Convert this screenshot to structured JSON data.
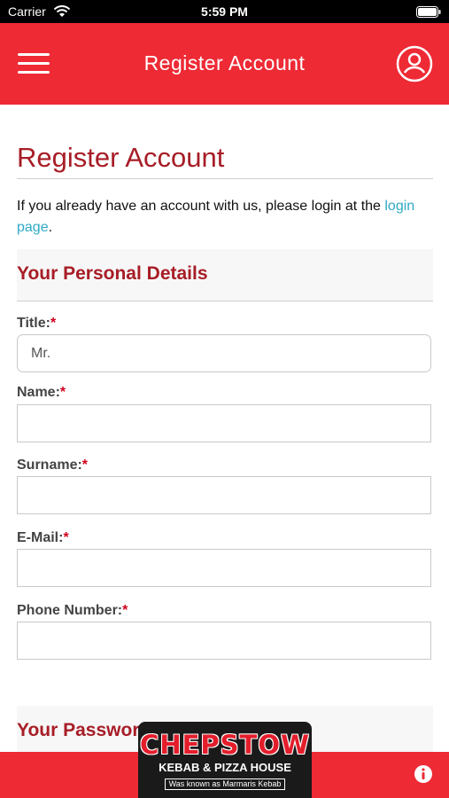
{
  "status": {
    "carrier": "Carrier",
    "time": "5:59 PM"
  },
  "header": {
    "title": "Register Account",
    "menu_icon": "hamburger-menu-icon",
    "account_icon": "user-circle-icon",
    "color": "#ee2a35"
  },
  "page": {
    "title": "Register Account",
    "intro_text": "If you already have an account with us, please login at the ",
    "intro_link": "login page",
    "intro_end": "."
  },
  "personal_section": {
    "title": "Your Personal Details",
    "fields": [
      {
        "label": "Title:",
        "value": "Mr."
      },
      {
        "label": "Name:",
        "value": ""
      },
      {
        "label": "Surname:",
        "value": ""
      },
      {
        "label": "E-Mail:",
        "value": ""
      },
      {
        "label": "Phone Number:",
        "value": ""
      }
    ],
    "required_mark": "*"
  },
  "password_section": {
    "title": "Your Password"
  },
  "footer": {
    "info_icon": "info-icon",
    "logo": {
      "name": "CHEPSTOW",
      "subtitle": "KEBAB & PIZZA HOUSE",
      "note": "Was known as Marmaris Kebab"
    }
  }
}
